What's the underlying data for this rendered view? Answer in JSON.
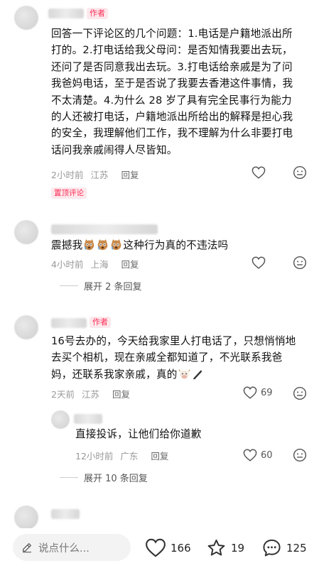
{
  "comments": [
    {
      "author_tag": "作者",
      "lines": [
        "回答一下评论区的几个问题：1.电话是户籍地派出所",
        "打的。2.打电话给我父母问：是否知情我要出去玩，",
        "还问了是否同意我出去玩。3.打电话给亲戚是为了问",
        "我爸妈电话，至于是否说了我要去香港这件事情，我",
        "不太清楚。4.为什么 28 岁了具有完全民事行为能力",
        "的人还被打电话，户籍地派出所给出的解释是担心我",
        "的安全，我理解他们工作，我不理解为什么非要打电",
        "话问我亲戚闹得人尽皆知。"
      ],
      "time": "2小时前",
      "location": "江苏",
      "reply_label": "回复",
      "like_count": "",
      "pinned_label": "置顶评论"
    },
    {
      "text_prefix": "震撼我",
      "text_suffix": "这种行为真的不违法吗",
      "time": "4小时前",
      "location": "上海",
      "reply_label": "回复",
      "like_count": "",
      "expand_label": "展开 2 条回复"
    },
    {
      "author_tag": "作者",
      "lines": [
        "16号去办的，今天给我家里人打电话了，只想悄悄地",
        "去买个相机，现在亲戚全都知道了，不光联系我爸",
        "妈，还联系我家亲戚，真的"
      ],
      "time": "2天前",
      "location": "江苏",
      "reply_label": "回复",
      "like_count": "69"
    },
    {
      "text": "直接投诉，让他们给你道歉",
      "time": "12小时前",
      "location": "广东",
      "reply_label": "回复",
      "like_count": "60",
      "expand_label": "展开 10 条回复"
    }
  ],
  "bottom_bar": {
    "input_placeholder": "说点什么...",
    "like_count": "166",
    "star_count": "19",
    "comment_count": "125"
  },
  "colors": {
    "accent": "#fe2c55",
    "meta": "#999999",
    "text": "#111111"
  }
}
